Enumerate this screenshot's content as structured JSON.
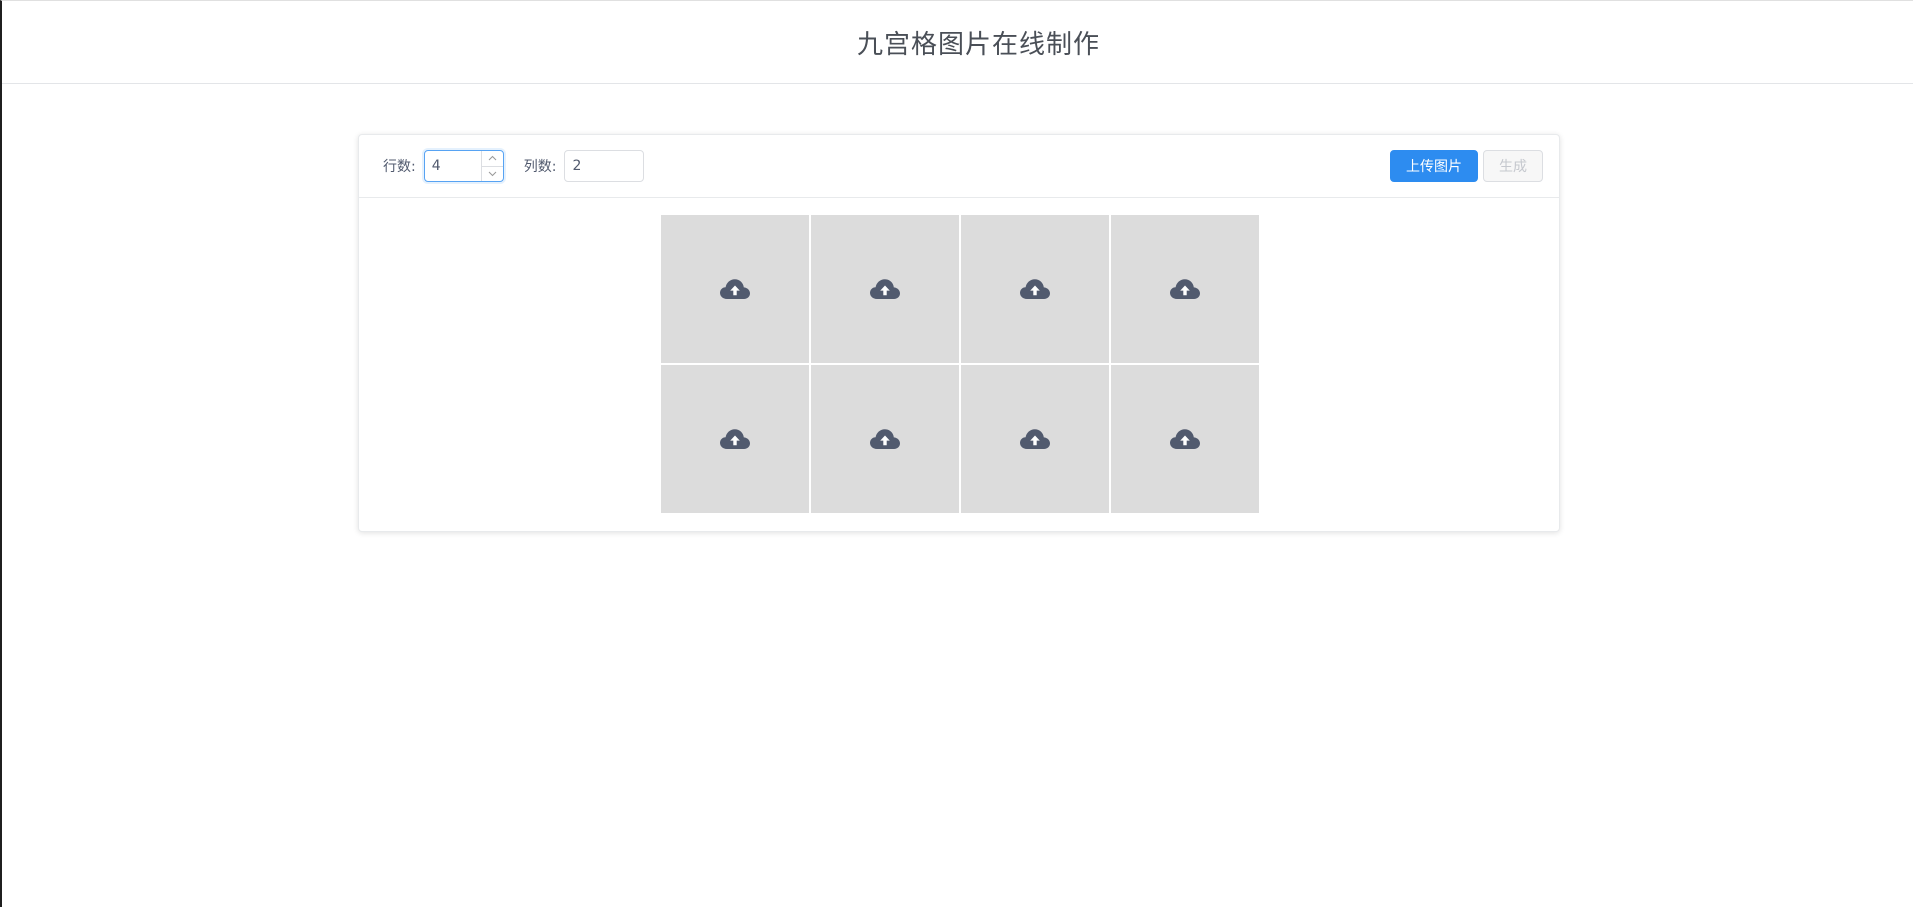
{
  "header": {
    "title": "九宫格图片在线制作"
  },
  "toolbar": {
    "rows_label": "行数:",
    "rows_value": "4",
    "cols_label": "列数:",
    "cols_value": "2",
    "upload_label": "上传图片",
    "generate_label": "生成"
  },
  "grid": {
    "cells": [
      {
        "icon": "cloud-upload-icon"
      },
      {
        "icon": "cloud-upload-icon"
      },
      {
        "icon": "cloud-upload-icon"
      },
      {
        "icon": "cloud-upload-icon"
      },
      {
        "icon": "cloud-upload-icon"
      },
      {
        "icon": "cloud-upload-icon"
      },
      {
        "icon": "cloud-upload-icon"
      },
      {
        "icon": "cloud-upload-icon"
      }
    ]
  },
  "colors": {
    "primary": "#2d8cf0",
    "cell_bg": "#dcdcdc",
    "icon": "#515a6e"
  }
}
